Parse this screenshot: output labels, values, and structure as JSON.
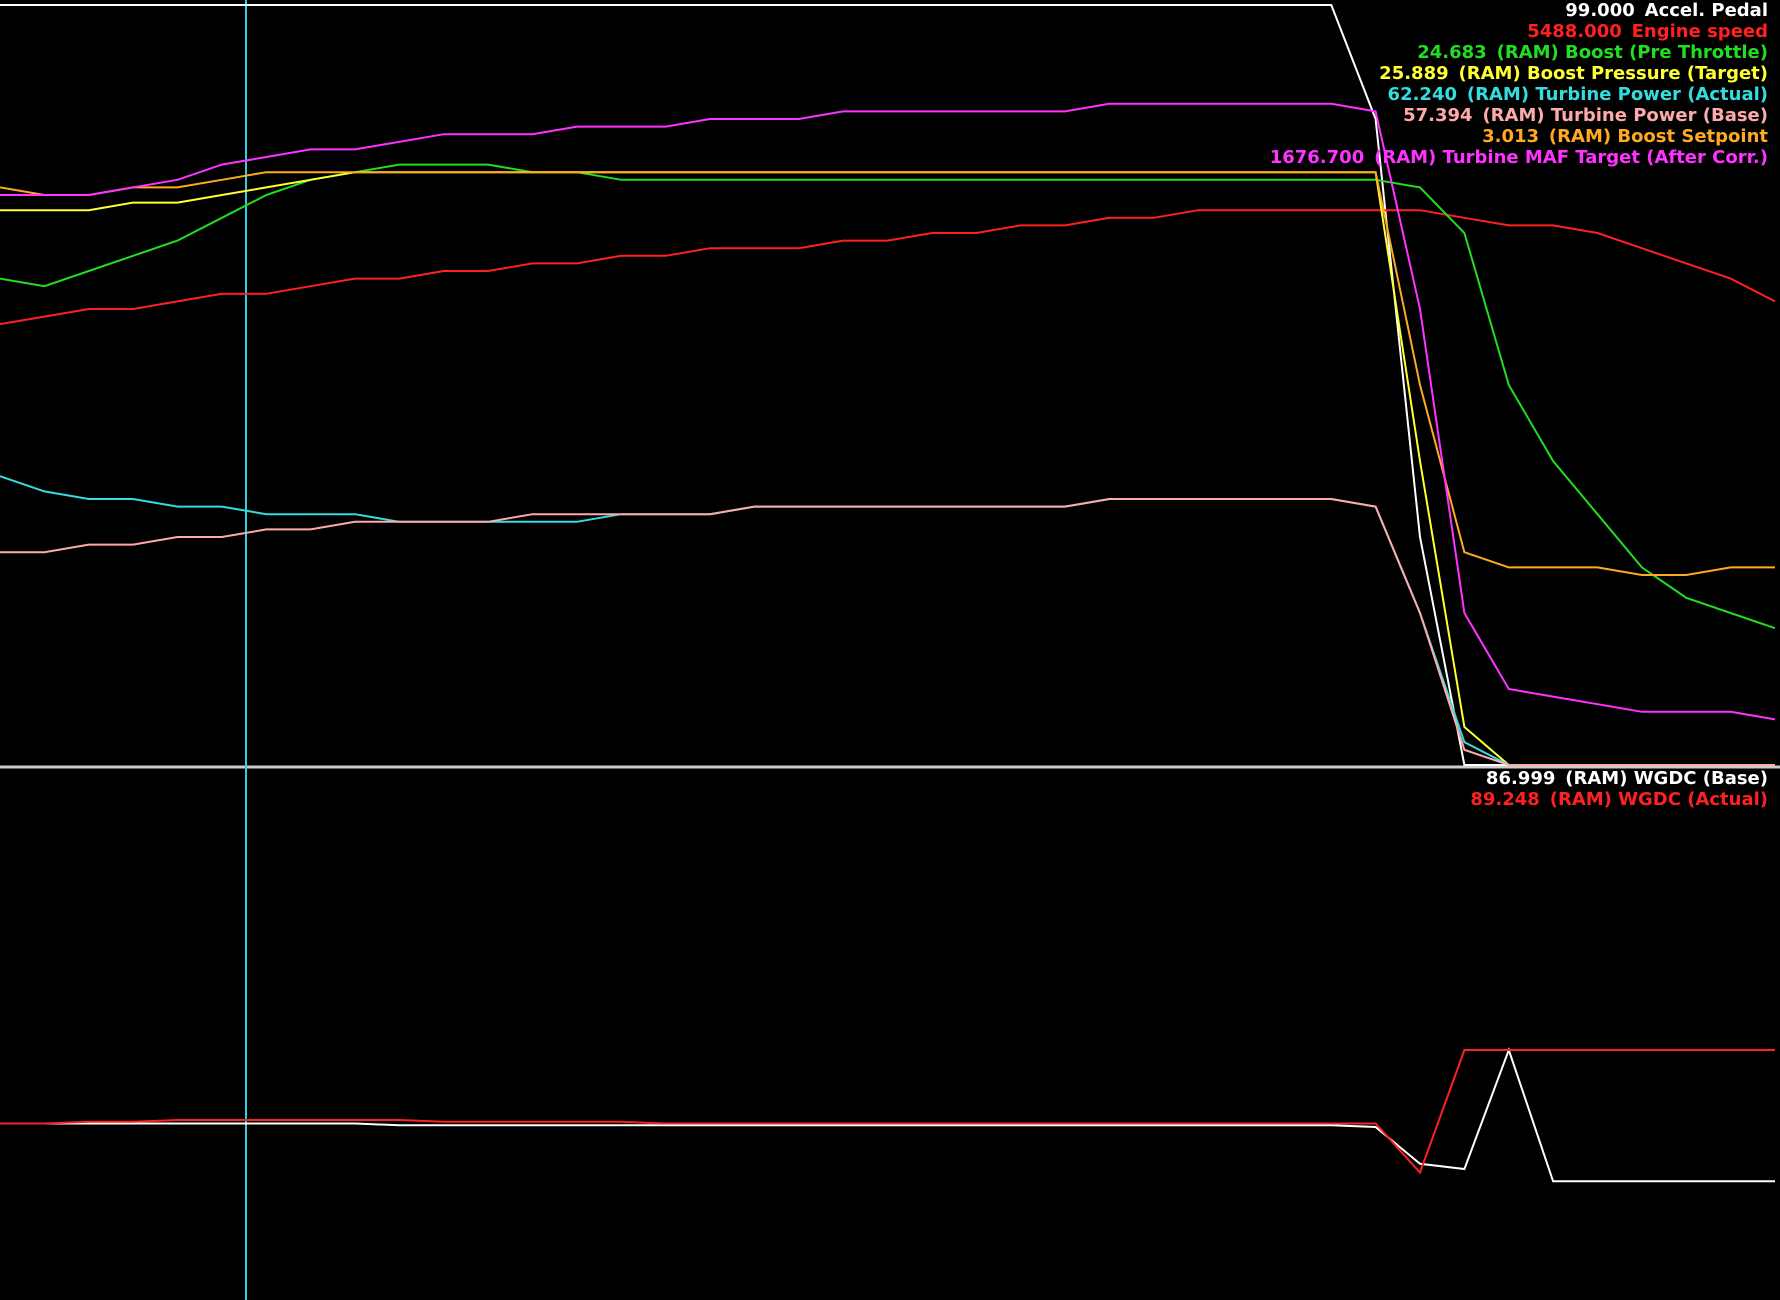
{
  "chart_data": [
    {
      "type": "line",
      "panel": "upper",
      "x": [
        0,
        1,
        2,
        3,
        4,
        5,
        6,
        7,
        8,
        9,
        10,
        11,
        12,
        13,
        14,
        15,
        16,
        17,
        18,
        19,
        20,
        21,
        22,
        23,
        24,
        25,
        26,
        27,
        28,
        29,
        30,
        31,
        32,
        33,
        34,
        35,
        36,
        37,
        38,
        39,
        40
      ],
      "series": [
        {
          "name": "Accel. Pedal",
          "value": "99.000",
          "color": "#ffffff",
          "values": [
            100,
            100,
            100,
            100,
            100,
            100,
            100,
            100,
            100,
            100,
            100,
            100,
            100,
            100,
            100,
            100,
            100,
            100,
            100,
            100,
            100,
            100,
            100,
            100,
            100,
            100,
            100,
            100,
            100,
            100,
            100,
            85,
            30,
            0,
            0,
            0,
            0,
            0,
            0,
            0,
            0
          ]
        },
        {
          "name": "Engine speed",
          "value": "5488.000",
          "color": "#ff2020",
          "values": [
            58,
            59,
            60,
            60,
            61,
            62,
            62,
            63,
            64,
            64,
            65,
            65,
            66,
            66,
            67,
            67,
            68,
            68,
            68,
            69,
            69,
            70,
            70,
            71,
            71,
            72,
            72,
            73,
            73,
            73,
            73,
            73,
            73,
            72,
            71,
            71,
            70,
            68,
            66,
            64,
            61
          ]
        },
        {
          "name": "(RAM) Boost (Pre Throttle)",
          "value": "24.683",
          "color": "#22dd22",
          "values": [
            64,
            63,
            65,
            67,
            69,
            72,
            75,
            77,
            78,
            79,
            79,
            79,
            78,
            78,
            77,
            77,
            77,
            77,
            77,
            77,
            77,
            77,
            77,
            77,
            77,
            77,
            77,
            77,
            77,
            77,
            77,
            77,
            76,
            70,
            50,
            40,
            33,
            26,
            22,
            20,
            18
          ]
        },
        {
          "name": "(RAM) Boost Pressure (Target)",
          "value": "25.889",
          "color": "#ffff33",
          "values": [
            73,
            73,
            73,
            74,
            74,
            75,
            76,
            77,
            78,
            78,
            78,
            78,
            78,
            78,
            78,
            78,
            78,
            78,
            78,
            78,
            78,
            78,
            78,
            78,
            78,
            78,
            78,
            78,
            78,
            78,
            78,
            78,
            40,
            5,
            0,
            0,
            0,
            0,
            0,
            0,
            0
          ]
        },
        {
          "name": "(RAM) Turbine Power (Actual)",
          "value": "62.240",
          "color": "#33dddd",
          "values": [
            38,
            36,
            35,
            35,
            34,
            34,
            33,
            33,
            33,
            32,
            32,
            32,
            32,
            32,
            33,
            33,
            33,
            34,
            34,
            34,
            34,
            34,
            34,
            34,
            34,
            35,
            35,
            35,
            35,
            35,
            35,
            34,
            20,
            3,
            0,
            0,
            0,
            0,
            0,
            0,
            0
          ]
        },
        {
          "name": "(RAM) Turbine Power (Base)",
          "value": "57.394",
          "color": "#ffaaaa",
          "values": [
            28,
            28,
            29,
            29,
            30,
            30,
            31,
            31,
            32,
            32,
            32,
            32,
            33,
            33,
            33,
            33,
            33,
            34,
            34,
            34,
            34,
            34,
            34,
            34,
            34,
            35,
            35,
            35,
            35,
            35,
            35,
            34,
            20,
            2,
            0,
            0,
            0,
            0,
            0,
            0,
            0
          ]
        },
        {
          "name": "(RAM) Boost Setpoint",
          "value": "3.013",
          "color": "#ffaa22",
          "values": [
            76,
            75,
            75,
            76,
            76,
            77,
            78,
            78,
            78,
            78,
            78,
            78,
            78,
            78,
            78,
            78,
            78,
            78,
            78,
            78,
            78,
            78,
            78,
            78,
            78,
            78,
            78,
            78,
            78,
            78,
            78,
            78,
            50,
            28,
            26,
            26,
            26,
            25,
            25,
            26,
            26
          ]
        },
        {
          "name": "(RAM) Turbine MAF Target (After Corr.)",
          "value": "1676.700",
          "color": "#ff33ff",
          "values": [
            75,
            75,
            75,
            76,
            77,
            79,
            80,
            81,
            81,
            82,
            83,
            83,
            83,
            84,
            84,
            84,
            85,
            85,
            85,
            86,
            86,
            86,
            86,
            86,
            86,
            87,
            87,
            87,
            87,
            87,
            87,
            86,
            60,
            20,
            10,
            9,
            8,
            7,
            7,
            7,
            6
          ]
        }
      ]
    },
    {
      "type": "line",
      "panel": "lower",
      "x": [
        0,
        1,
        2,
        3,
        4,
        5,
        6,
        7,
        8,
        9,
        10,
        11,
        12,
        13,
        14,
        15,
        16,
        17,
        18,
        19,
        20,
        21,
        22,
        23,
        24,
        25,
        26,
        27,
        28,
        29,
        30,
        31,
        32,
        33,
        34,
        35,
        36,
        37,
        38,
        39,
        40
      ],
      "series": [
        {
          "name": "(RAM) WGDC (Base)",
          "value": "86.999",
          "color": "#ffffff",
          "values": [
            38,
            38,
            38,
            38,
            38,
            38,
            38,
            38,
            38,
            37,
            37,
            37,
            37,
            37,
            37,
            37,
            37,
            37,
            37,
            37,
            37,
            37,
            37,
            37,
            37,
            37,
            37,
            37,
            37,
            37,
            37,
            36,
            15,
            12,
            80,
            5,
            5,
            5,
            5,
            5,
            5
          ]
        },
        {
          "name": "(RAM) WGDC (Actual)",
          "value": "89.248",
          "color": "#ff2020",
          "values": [
            38,
            38,
            39,
            39,
            40,
            40,
            40,
            40,
            40,
            40,
            39,
            39,
            39,
            39,
            39,
            38,
            38,
            38,
            38,
            38,
            38,
            38,
            38,
            38,
            38,
            38,
            38,
            38,
            38,
            38,
            38,
            38,
            10,
            80,
            80,
            80,
            80,
            80,
            80,
            80,
            80
          ]
        }
      ]
    }
  ]
}
